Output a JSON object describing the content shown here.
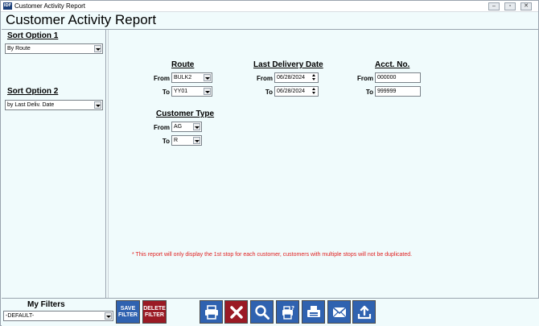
{
  "window": {
    "title": "Customer Activity Report",
    "icon_text": "IDF"
  },
  "report_title": "Customer Activity Report",
  "sort_option_1": {
    "label": "Sort Option 1",
    "value": "By Route"
  },
  "sort_option_2": {
    "label": "Sort Option 2",
    "value": "by Last Deliv. Date"
  },
  "route": {
    "title": "Route",
    "from_label": "From",
    "from_value": "BULK2",
    "to_label": "To",
    "to_value": "YY01"
  },
  "last_delivery_date": {
    "title": "Last Delivery Date",
    "from_label": "From",
    "from_value": "06/28/2024",
    "to_label": "To",
    "to_value": "06/28/2024"
  },
  "acct_no": {
    "title": "Acct. No.",
    "from_label": "From",
    "from_value": "000000",
    "to_label": "To",
    "to_value": "999999"
  },
  "customer_type": {
    "title": "Customer Type",
    "from_label": "From",
    "from_value": "AG",
    "to_label": "To",
    "to_value": "R"
  },
  "note": "* This report will only display the 1st stop for each customer, customers with multiple stops will not be duplicated.",
  "my_filters": {
    "label": "My Filters",
    "value": "-DEFAULT-"
  },
  "buttons": {
    "save_filter": "SAVE FILTER",
    "delete_filter": "DELETE FILTER"
  },
  "colors": {
    "button_blue": "#2f62b0",
    "button_red": "#9a1a24",
    "note_red": "#e02020",
    "background": "#f0fbfc"
  },
  "toolbar_icons": [
    "printer-icon",
    "close-x-icon",
    "magnifier-icon",
    "print-settings-icon",
    "fax-icon",
    "email-icon",
    "export-icon"
  ]
}
